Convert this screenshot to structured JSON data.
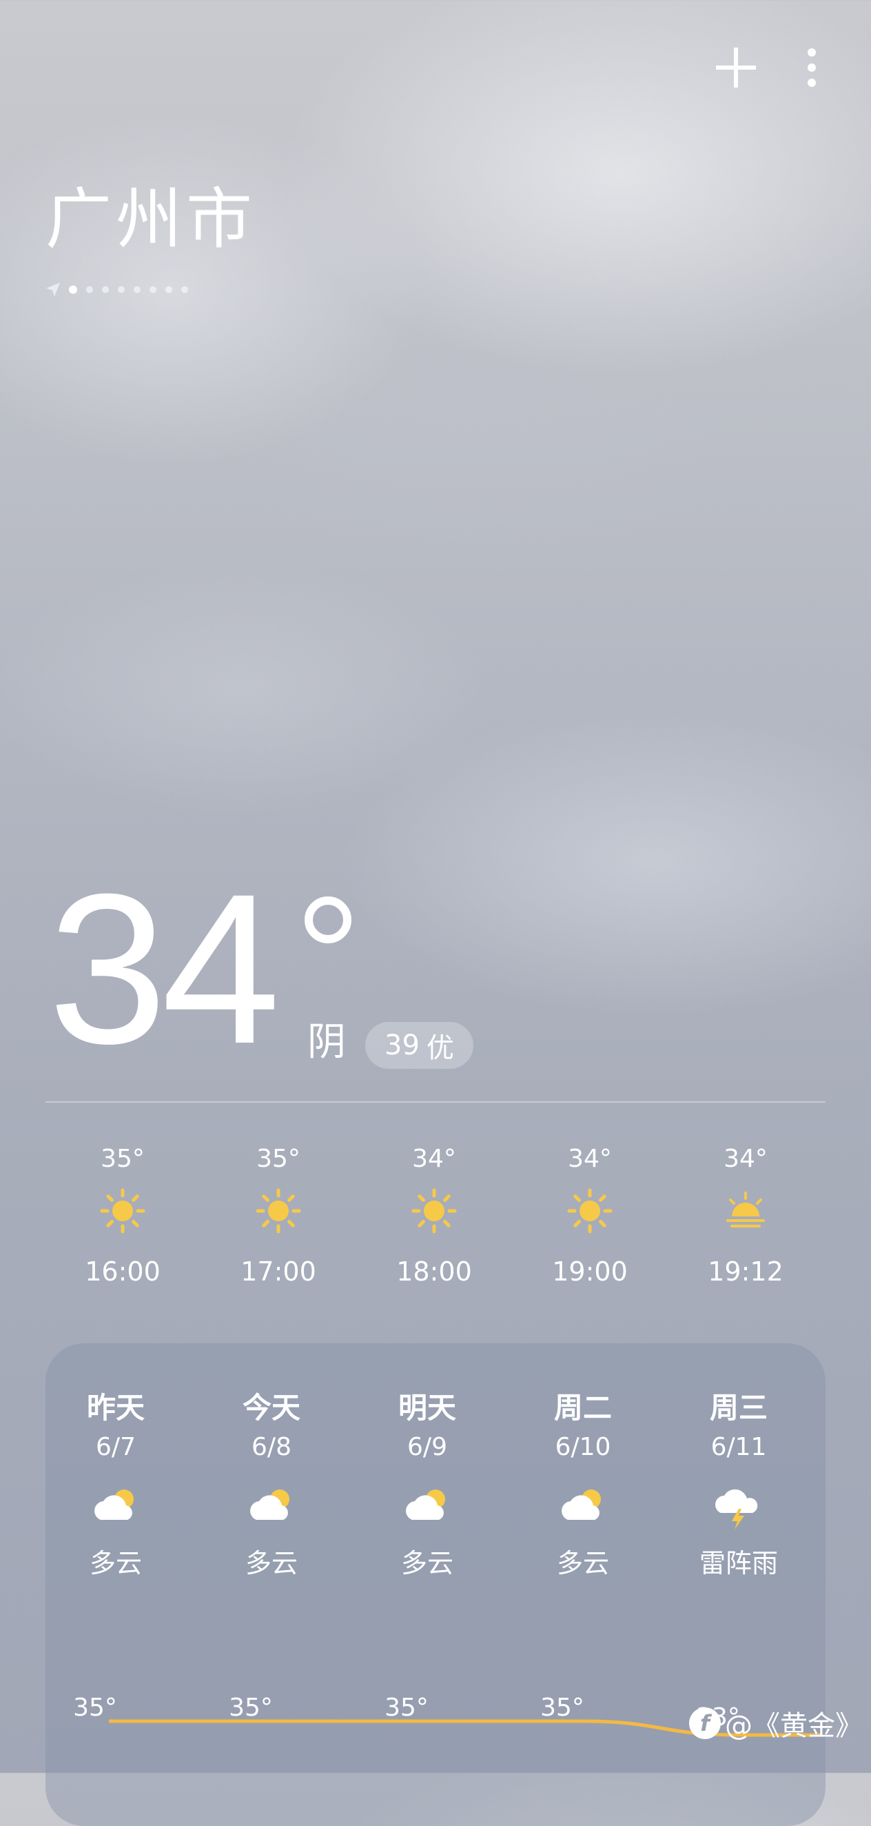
{
  "city": "广州市",
  "pages": {
    "count": 8,
    "active_index": 0
  },
  "current": {
    "temperature": "34",
    "condition": "阴",
    "aqi_value": "39",
    "aqi_label": "优"
  },
  "hourly": [
    {
      "temp": "35°",
      "icon": "sun-icon",
      "time": "16:00"
    },
    {
      "temp": "35°",
      "icon": "sun-icon",
      "time": "17:00"
    },
    {
      "temp": "34°",
      "icon": "sun-icon",
      "time": "18:00"
    },
    {
      "temp": "34°",
      "icon": "sun-icon",
      "time": "19:00"
    },
    {
      "temp": "34°",
      "icon": "sunset-icon",
      "time": "19:12"
    }
  ],
  "daily": [
    {
      "name": "昨天",
      "date": "6/7",
      "icon": "partly-cloudy-icon",
      "condition": "多云",
      "high": "35°"
    },
    {
      "name": "今天",
      "date": "6/8",
      "icon": "partly-cloudy-icon",
      "condition": "多云",
      "high": "35°"
    },
    {
      "name": "明天",
      "date": "6/9",
      "icon": "partly-cloudy-icon",
      "condition": "多云",
      "high": "35°"
    },
    {
      "name": "周二",
      "date": "6/10",
      "icon": "partly-cloudy-icon",
      "condition": "多云",
      "high": "35°"
    },
    {
      "name": "周三",
      "date": "6/11",
      "icon": "thunderstorm-icon",
      "condition": "雷阵雨",
      "high": "33°"
    }
  ],
  "colors": {
    "sun": "#f7c948",
    "trend_line": "#f4b942"
  },
  "watermark": {
    "text": "@《黄金》",
    "logo": "f"
  }
}
